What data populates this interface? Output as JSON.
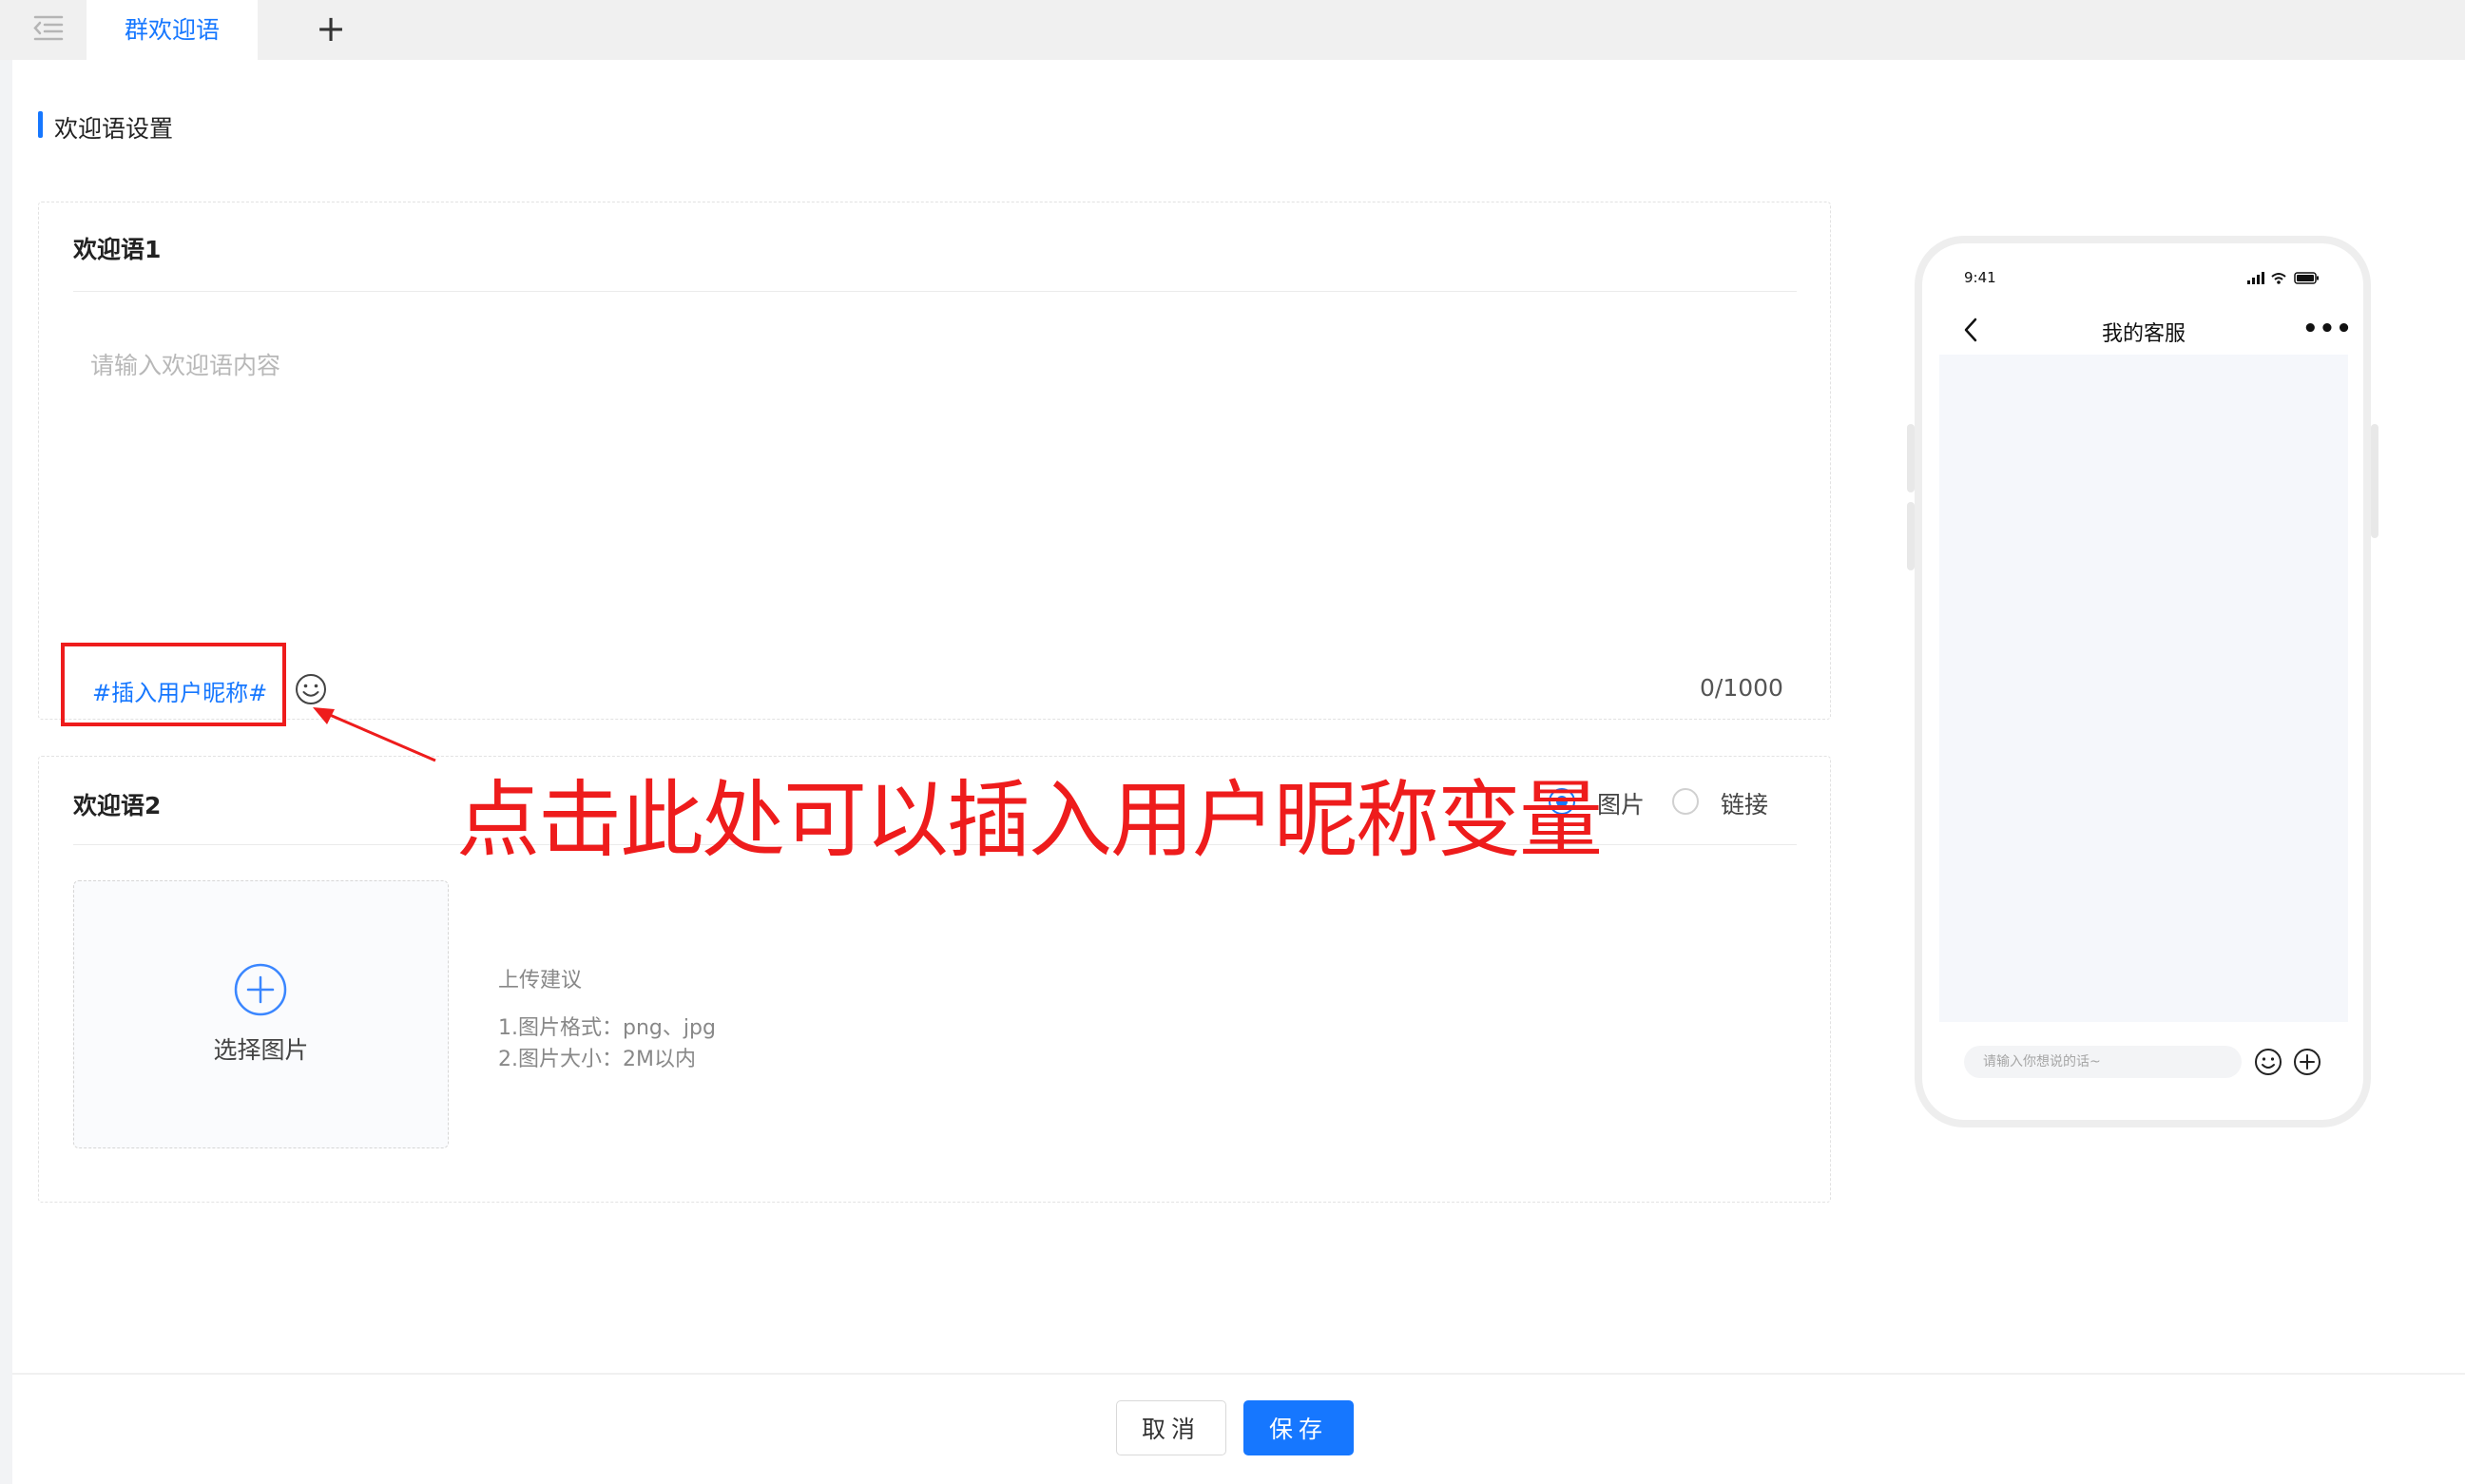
{
  "tabs": {
    "menu_icon": "menu-fold-icon",
    "active_label": "群欢迎语",
    "add_label": "+"
  },
  "section": {
    "title": "欢迎语设置"
  },
  "welcome1": {
    "title": "欢迎语1",
    "placeholder": "请输入欢迎语内容",
    "value": "",
    "insert_nickname_label": "#插入用户昵称#",
    "emoji_icon": "smile-icon",
    "char_count": "0/1000"
  },
  "annotation": {
    "text": "点击此处可以插入用户昵称变量",
    "color": "#ee1c1c"
  },
  "welcome2": {
    "title": "欢迎语2",
    "type_options": [
      {
        "label": "图片",
        "selected": true
      },
      {
        "label": "链接",
        "selected": false
      }
    ],
    "upload_label": "选择图片",
    "upload_tips_title": "上传建议",
    "upload_tips": [
      "1.图片格式：png、jpg",
      "2.图片大小：2M以内"
    ]
  },
  "phone": {
    "time": "9:41",
    "title": "我的客服",
    "more": "•••",
    "input_placeholder": "请输入你想说的话~"
  },
  "footer": {
    "cancel_label": "取消",
    "save_label": "保存"
  },
  "colors": {
    "primary": "#1677ff",
    "annotation_red": "#ee1c1c"
  }
}
